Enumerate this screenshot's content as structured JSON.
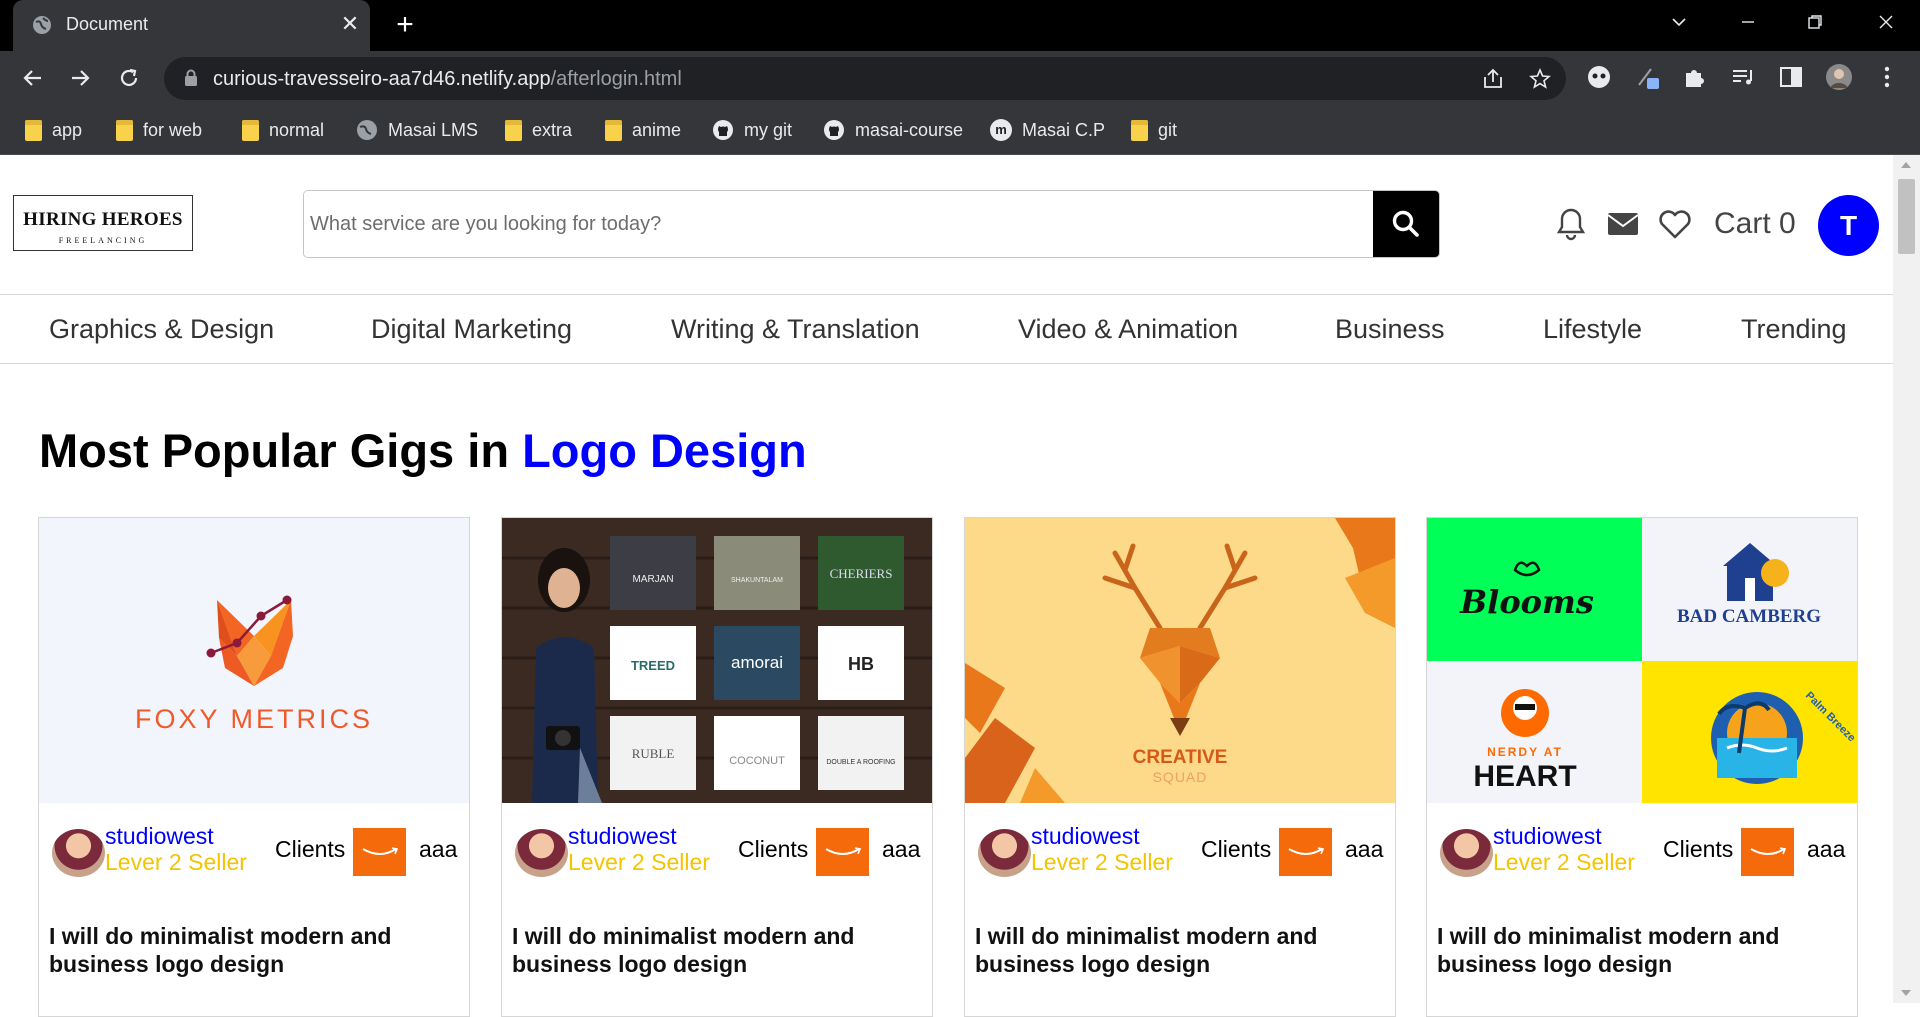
{
  "browser": {
    "tab_title": "Document",
    "tab_close": "✕",
    "new_tab": "+",
    "url_host": "curious-travesseiro-aa7d46.netlify.app",
    "url_path": "/afterlogin.html",
    "bookmarks": [
      {
        "label": "app",
        "icon": "folder-icon"
      },
      {
        "label": "for web",
        "icon": "folder-icon"
      },
      {
        "label": "normal",
        "icon": "folder-icon"
      },
      {
        "label": "Masai LMS",
        "icon": "globe-icon"
      },
      {
        "label": "extra",
        "icon": "folder-icon"
      },
      {
        "label": "anime",
        "icon": "folder-icon"
      },
      {
        "label": "my git",
        "icon": "github-icon"
      },
      {
        "label": "masai-course",
        "icon": "github-icon"
      },
      {
        "label": "Masai C.P",
        "icon": "masai-icon"
      },
      {
        "label": "git",
        "icon": "folder-icon"
      }
    ],
    "masai_icon_letter": "m"
  },
  "header": {
    "logo_line1": "HIRING HEROES",
    "logo_line2": "FREELANCING",
    "search_placeholder": "What service are you looking for today?",
    "cart_label": "Cart 0",
    "avatar_letter": "T",
    "accent_color": "#0000ff"
  },
  "categories": [
    "Graphics & Design",
    "Digital Marketing",
    "Writing & Translation",
    "Video & Animation",
    "Business",
    "Lifestyle",
    "Trending"
  ],
  "section": {
    "heading_prefix": "Most Popular Gigs in",
    "heading_accent": "Logo Design"
  },
  "gigs": [
    {
      "seller": "studiowest",
      "level": "Lever 2 Seller",
      "clients_label": "Clients",
      "client_name": "aaa",
      "title": "I will do minimalist modern and business logo design",
      "thumb_text": "FOXY METRICS"
    },
    {
      "seller": "studiowest",
      "level": "Lever 2 Seller",
      "clients_label": "Clients",
      "client_name": "aaa",
      "title": "I will do minimalist modern and business logo design",
      "thumb_logos": [
        "MARJAN",
        "SHAKUNTALAM",
        "CHERIERS",
        "TREED",
        "amorai",
        "HB",
        "RUBLE",
        "COCONUT",
        "DOUBLE A ROOFING"
      ]
    },
    {
      "seller": "studiowest",
      "level": "Lever 2 Seller",
      "clients_label": "Clients",
      "client_name": "aaa",
      "title": "I will do minimalist modern and business logo design",
      "thumb_text": "CREATIVE",
      "thumb_subtext": "SQUAD"
    },
    {
      "seller": "studiowest",
      "level": "Lever 2 Seller",
      "clients_label": "Clients",
      "client_name": "aaa",
      "title": "I will do minimalist modern and business logo design",
      "thumb_logos": [
        "Blooms",
        "BAD CAMBERG",
        "NERDY AT",
        "HEART",
        "Palm Breeze"
      ]
    }
  ]
}
